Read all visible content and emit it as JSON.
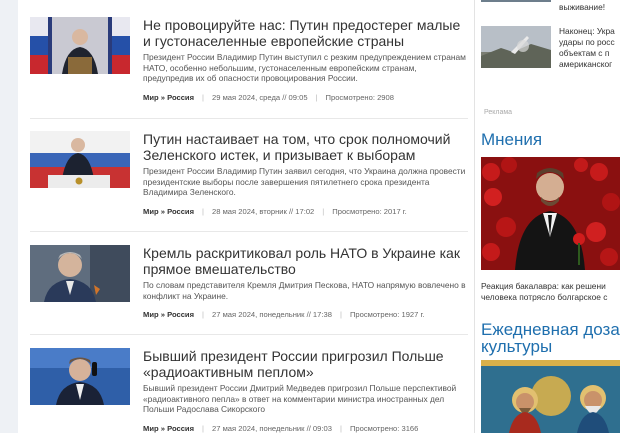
{
  "articles": [
    {
      "title": "Не провоцируйте нас: Путин предостерег малые и густонаселенные европейские страны",
      "lead": "Президент России Владимир Путин выступил с резким предупреждением странам НАТО, особенно небольшим, густонаселенным европейским странам, предупредив их об опасности провоцирования России.",
      "category": "Мир » Россия",
      "date": "29 мая 2024, среда // 09:05",
      "views": "Просмотрено: 2908"
    },
    {
      "title": "Путин настаивает на том, что срок полномочий Зеленского истек, и призывает к выборам",
      "lead": "Президент России Владимир Путин заявил сегодня, что Украина должна провести президентские выборы после завершения пятилетнего срока президента Владимира Зеленского.",
      "category": "Мир » Россия",
      "date": "28 мая 2024, вторник // 17:02",
      "views": "Просмотрено: 2017 г."
    },
    {
      "title": "Кремль раскритиковал роль НАТО в Украине как прямое вмешательство",
      "lead": "По словам представителя Кремля Дмитрия Пескова, НАТО напрямую вовлечено в конфликт на Украине.",
      "category": "Мир » Россия",
      "date": "27 мая 2024, понедельник // 17:38",
      "views": "Просмотрено: 1927 г."
    },
    {
      "title": "Бывший президент России пригрозил Польше «радиоактивным пеплом»",
      "lead": "Бывший президент России Дмитрий Медведев пригрозил Польше перспективой «радиоактивного пепла» в ответ на комментарии министра иностранных дел Польши Радослава Сикорского",
      "category": "Мир » Россия",
      "date": "27 мая 2024, понедельник // 09:03",
      "views": "Просмотрено: 3166"
    }
  ],
  "sidebar": {
    "top_text": "выживание!",
    "news_item": "Наконец: Укра удары по росс объектам с п американског",
    "ad_label": "Реклама",
    "opinions_heading": "Мнения",
    "opinion_caption": "Реакция бакалавра: как решени человека потрясло болгарское с",
    "culture_heading": "Ежедневная доза культуры"
  }
}
